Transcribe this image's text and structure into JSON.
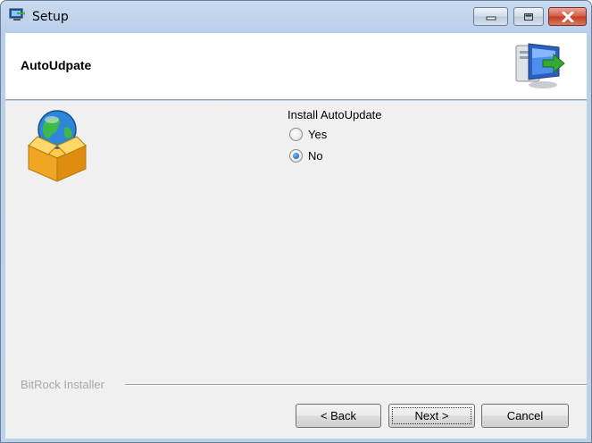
{
  "window": {
    "title": "Setup"
  },
  "header": {
    "title": "AutoUdpate"
  },
  "options": {
    "group_label": "Install AutoUpdate",
    "items": [
      {
        "label": "Yes",
        "selected": false
      },
      {
        "label": "No",
        "selected": true
      }
    ]
  },
  "footer": {
    "brand": "BitRock Installer",
    "back_label": "< Back",
    "next_label": "Next >",
    "cancel_label": "Cancel"
  },
  "icons": {
    "app": "setup-app-icon",
    "header_logo": "computer-install-icon",
    "content": "globe-in-box-icon",
    "minimize": "minimize-icon",
    "maximize": "maximize-icon",
    "close": "close-icon"
  }
}
